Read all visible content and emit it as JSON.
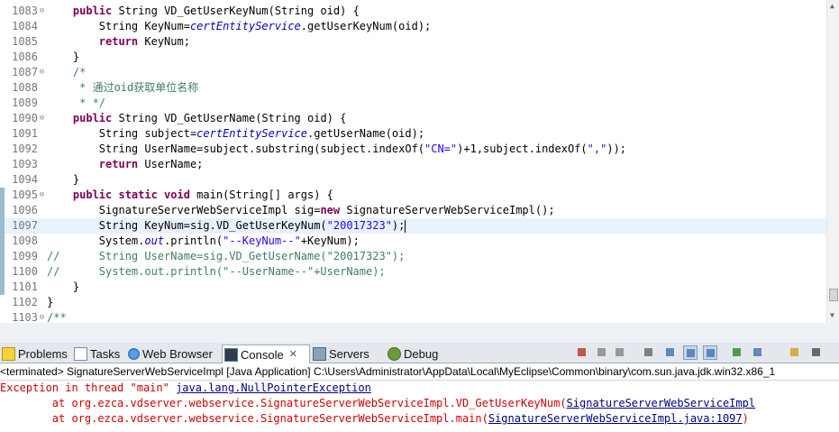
{
  "editor": {
    "lines": [
      {
        "num": "1083",
        "fold": "⊖",
        "segs": [
          {
            "t": "    "
          },
          {
            "t": "public",
            "c": "kw"
          },
          {
            "t": " String VD_GetUserKeyNum(String oid) {"
          }
        ]
      },
      {
        "num": "1084",
        "segs": [
          {
            "t": "        String KeyNum="
          },
          {
            "t": "certEntityService",
            "c": "fld"
          },
          {
            "t": ".getUserKeyNum(oid);"
          }
        ]
      },
      {
        "num": "1085",
        "segs": [
          {
            "t": "        "
          },
          {
            "t": "return",
            "c": "kw"
          },
          {
            "t": " KeyNum;"
          }
        ]
      },
      {
        "num": "1086",
        "segs": [
          {
            "t": "    }"
          }
        ]
      },
      {
        "num": "1087",
        "fold": "⊖",
        "segs": [
          {
            "t": "    /*",
            "c": "cmt"
          }
        ]
      },
      {
        "num": "1088",
        "segs": [
          {
            "t": "     * 通过oid获取单位名称",
            "c": "cmt"
          }
        ]
      },
      {
        "num": "1089",
        "segs": [
          {
            "t": "     * */",
            "c": "cmt"
          }
        ]
      },
      {
        "num": "1090",
        "fold": "⊖",
        "segs": [
          {
            "t": "    "
          },
          {
            "t": "public",
            "c": "kw"
          },
          {
            "t": " String VD_GetUserName(String oid) {"
          }
        ]
      },
      {
        "num": "1091",
        "segs": [
          {
            "t": "        String subject="
          },
          {
            "t": "certEntityService",
            "c": "fld"
          },
          {
            "t": ".getUserName(oid);"
          }
        ]
      },
      {
        "num": "1092",
        "segs": [
          {
            "t": "        String UserName=subject.substring(subject.indexOf("
          },
          {
            "t": "\"CN=\"",
            "c": "str"
          },
          {
            "t": ")+1,subject.indexOf("
          },
          {
            "t": "\",\"",
            "c": "str"
          },
          {
            "t": "));"
          }
        ]
      },
      {
        "num": "1093",
        "segs": [
          {
            "t": "        "
          },
          {
            "t": "return",
            "c": "kw"
          },
          {
            "t": " UserName;"
          }
        ]
      },
      {
        "num": "1094",
        "segs": [
          {
            "t": "    }"
          }
        ]
      },
      {
        "num": "1095",
        "fold": "⊖",
        "mark": true,
        "segs": [
          {
            "t": "    "
          },
          {
            "t": "public static void",
            "c": "kw"
          },
          {
            "t": " main(String[] args) {"
          }
        ]
      },
      {
        "num": "1096",
        "mark": true,
        "segs": [
          {
            "t": "        SignatureServerWebServiceImpl sig="
          },
          {
            "t": "new",
            "c": "kw"
          },
          {
            "t": " SignatureServerWebServiceImpl();"
          }
        ]
      },
      {
        "num": "1097",
        "mark": true,
        "current": true,
        "segs": [
          {
            "t": "        String KeyNum=sig.VD_GetUserKeyNum("
          },
          {
            "t": "\"20017323\"",
            "c": "str"
          },
          {
            "t": ");"
          },
          {
            "cursor": true
          }
        ]
      },
      {
        "num": "1098",
        "mark": true,
        "segs": [
          {
            "t": "        System."
          },
          {
            "t": "out",
            "c": "fld"
          },
          {
            "t": ".println("
          },
          {
            "t": "\"--KeyNum--\"",
            "c": "str"
          },
          {
            "t": "+KeyNum);"
          }
        ]
      },
      {
        "num": "1099",
        "mark": true,
        "segs": [
          {
            "t": "//      String UserName=sig.VD_GetUserName(\"20017323\");",
            "c": "cmt"
          }
        ]
      },
      {
        "num": "1100",
        "mark": true,
        "segs": [
          {
            "t": "//      System.out.println(\"--UserName--\"+UserName);",
            "c": "cmt"
          }
        ]
      },
      {
        "num": "1101",
        "mark": true,
        "segs": [
          {
            "t": "    }"
          }
        ]
      },
      {
        "num": "1102",
        "segs": [
          {
            "t": "}"
          }
        ]
      },
      {
        "num": "1103",
        "fold": "⊖",
        "segs": [
          {
            "t": "/**",
            "c": "cmt"
          }
        ]
      }
    ]
  },
  "tabs": [
    {
      "label": "Problems",
      "icon": "problems-icon",
      "name": "tab-problems"
    },
    {
      "label": "Tasks",
      "icon": "tasks-icon",
      "name": "tab-tasks"
    },
    {
      "label": "Web Browser",
      "icon": "web-browser-icon",
      "name": "tab-web-browser"
    },
    {
      "label": "Console",
      "icon": "console-icon",
      "name": "tab-console",
      "active": true,
      "closable": "✕"
    },
    {
      "label": "Servers",
      "icon": "servers-icon",
      "name": "tab-servers"
    },
    {
      "label": "Debug",
      "icon": "debug-icon",
      "name": "tab-debug"
    }
  ],
  "toolbar": [
    {
      "icon": "terminate-icon",
      "name": "terminate-button"
    },
    {
      "icon": "remove-launch-icon",
      "name": "remove-launch-button"
    },
    {
      "icon": "remove-all-terminated-icon",
      "name": "remove-all-terminated-button"
    },
    {
      "icon": "clear-console-icon",
      "name": "clear-console-button"
    },
    {
      "icon": "scroll-lock-icon",
      "name": "scroll-lock-button"
    },
    {
      "icon": "word-wrap-icon",
      "name": "word-wrap-button",
      "pressed": true
    },
    {
      "icon": "show-console-icon",
      "name": "show-console-button",
      "pressed": true
    },
    {
      "icon": "pin-console-icon",
      "name": "pin-console-button"
    },
    {
      "icon": "display-selected-console-icon",
      "name": "display-selected-console-button"
    },
    {
      "icon": "open-console-icon",
      "name": "open-console-button"
    },
    {
      "icon": "minimize-icon",
      "name": "minimize-view-button"
    }
  ],
  "console": {
    "header": "<terminated> SignatureServerWebServiceImpl [Java Application] C:\\Users\\Administrator\\AppData\\Local\\MyEclipse\\Common\\binary\\com.sun.java.jdk.win32.x86_1",
    "exception_prefix": "Exception in thread \"main\" ",
    "exception_link": "java.lang.NullPointerException",
    "trace": [
      {
        "prefix": "\tat org.ezca.vdserver.webservice.SignatureServerWebServiceImpl.VD_GetUserKeyNum(",
        "link": "SignatureServerWebServiceImpl"
      },
      {
        "prefix": "\tat org.ezca.vdserver.webservice.SignatureServerWebServiceImpl.main(",
        "link": "SignatureServerWebServiceImpl.java:1097",
        "suffix": ")"
      }
    ]
  },
  "colors": {
    "keyword": "#7f0055",
    "field": "#0000c0",
    "string": "#2a00ff",
    "comment": "#3f7f5f",
    "error": "#d00000",
    "link": "#000080"
  }
}
